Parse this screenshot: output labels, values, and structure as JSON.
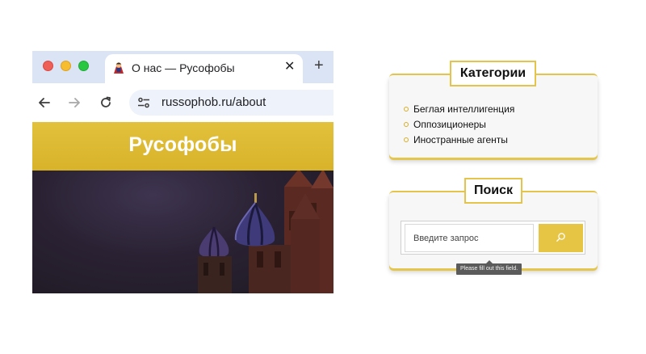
{
  "browser": {
    "tab": {
      "title": "О нас — Русофобы",
      "favicon": "superhero-favicon-icon",
      "close": "✕"
    },
    "new_tab": "+",
    "address": {
      "url": "russophob.ru/about",
      "site_icon": "site-settings-icon"
    },
    "nav": {
      "back": "back-arrow-icon",
      "forward": "forward-arrow-icon",
      "reload": "reload-icon"
    },
    "traffic_lights": {
      "close": "#ee5f57",
      "minimize": "#f5bd2f",
      "zoom": "#28c741"
    }
  },
  "site": {
    "title": "Русофобы",
    "header_color": "#dcb834",
    "hero": "kremlin-cathedral-night-image"
  },
  "categories_widget": {
    "title": "Категории",
    "items": [
      "Беглая интеллигенция",
      "Оппозиционеры",
      "Иностранные агенты"
    ]
  },
  "search_widget": {
    "title": "Поиск",
    "placeholder": "Введите запрос",
    "button_icon": "search-icon",
    "tooltip": "Please fill out this field."
  },
  "colors": {
    "accent": "#e4c44a",
    "widget_bg": "#f7f7f7"
  }
}
